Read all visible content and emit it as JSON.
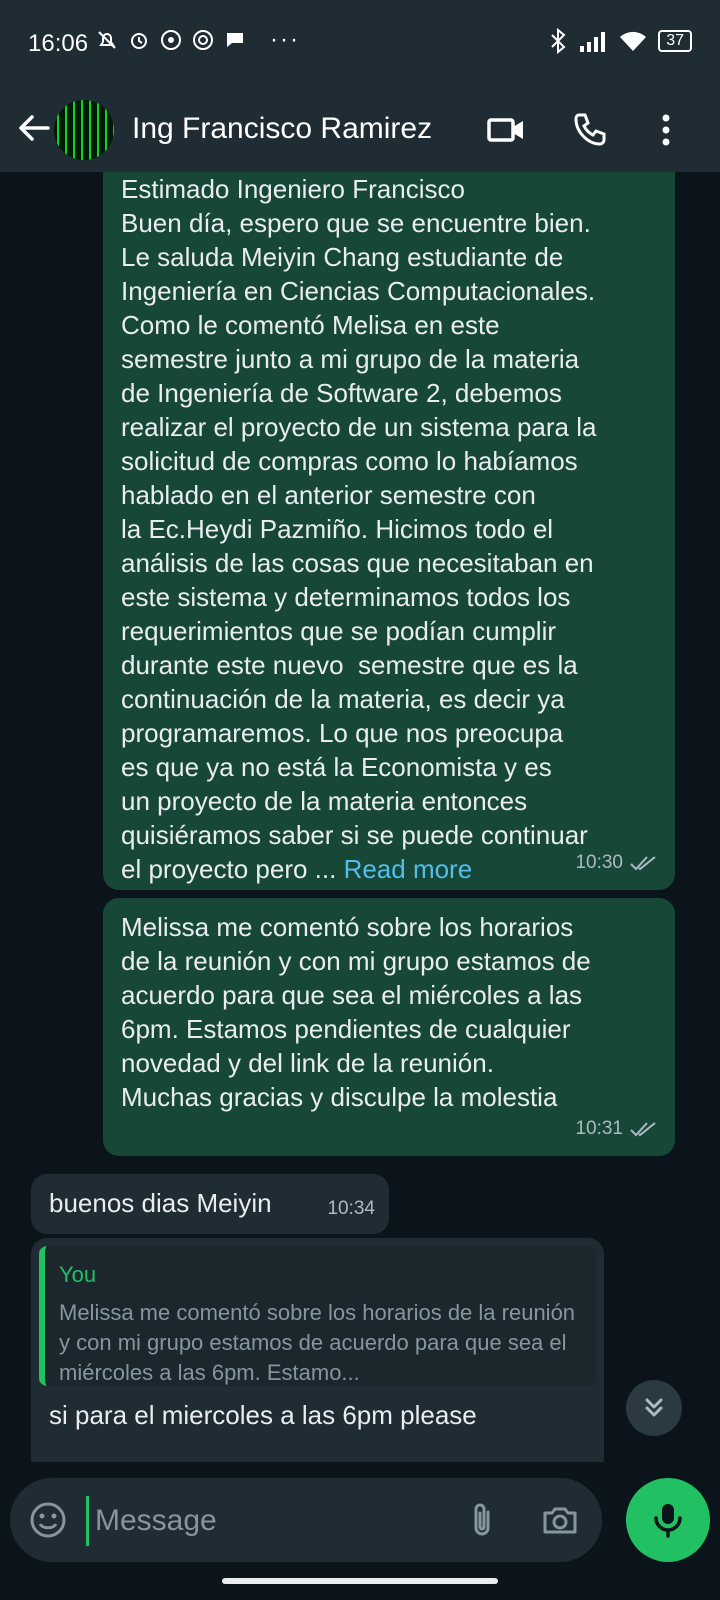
{
  "status": {
    "time": "16:06",
    "dots": "···",
    "battery": "37"
  },
  "header": {
    "contact_name": "Ing Francisco Ramirez"
  },
  "messages": [
    {
      "text": "Estimado Ingeniero Francisco\nBuen día, espero que se encuentre bien.\nLe saluda Meiyin Chang estudiante de\nIngeniería en Ciencias Computacionales.\nComo le comentó Melisa en este\nsemestre junto a mi grupo de la materia\nde Ingeniería de Software 2, debemos\nrealizar el proyecto de un sistema para la\nsolicitud de compras como lo habíamos\nhablado en el anterior semestre con\nla Ec.Heydi Pazmiño. Hicimos todo el\nanálisis de las cosas que necesitaban en\neste sistema y determinamos todos los\nrequerimientos que se podían cumplir\ndurante este nuevo  semestre que es la\ncontinuación de la materia, es decir ya\nprogramaremos. Lo que nos preocupa\nes que ya no está la Economista y es\nun proyecto de la materia entonces\nquisiéramos saber si se puede continuar\nel proyecto pero ... ",
      "read_more": "Read more",
      "time": "10:30"
    },
    {
      "text": "Melissa me comentó sobre los horarios\nde la reunión y con mi grupo estamos de\nacuerdo para que sea el miércoles a las\n6pm. Estamos pendientes de cualquier\nnovedad y del link de la reunión.\nMuchas gracias y disculpe la molestia",
      "time": "10:31"
    },
    {
      "text": "buenos dias Meiyin",
      "time": "10:34"
    },
    {
      "quote_author": "You",
      "quote_text": "Melissa me comentó sobre los horarios de la reunión y con mi grupo estamos de acuerdo para que sea el miércoles a las 6pm. Estamo...",
      "text": "si para el miercoles a las 6pm please"
    }
  ],
  "composer": {
    "placeholder": "Message"
  },
  "colors": {
    "background": "#0b141a",
    "outgoing_bubble": "#174737",
    "incoming_bubble": "#1f2c34",
    "accent_green": "#21c063",
    "link_blue": "#53bdeb"
  }
}
